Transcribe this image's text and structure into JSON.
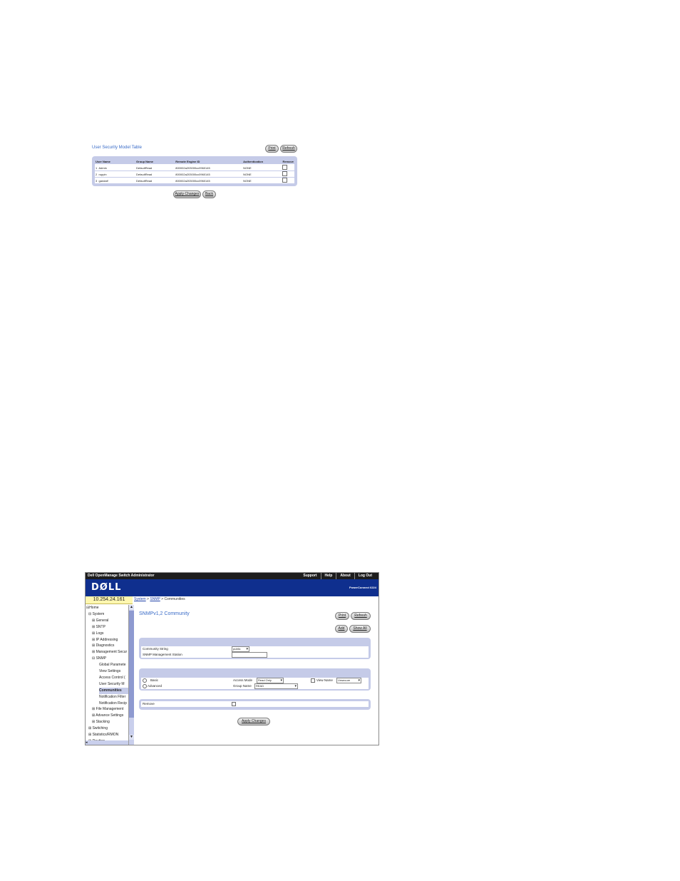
{
  "usm": {
    "title": "User Security Model Table",
    "print_label": "Print",
    "refresh_label": "Refresh",
    "columns": [
      "User Name",
      "Group Name",
      "Remote Engine ID",
      "Authentication",
      "Remove"
    ],
    "rows": [
      {
        "index": "1",
        "user": "Admin",
        "group": "DefaultRead",
        "engine": "800002a203000cc0960145",
        "auth": "NONE"
      },
      {
        "index": "2",
        "user": "ruppin",
        "group": "DefaultRead",
        "engine": "800002a203000cc0960145",
        "auth": "NONE"
      },
      {
        "index": "3",
        "user": "gandalf",
        "group": "DefaultRead",
        "engine": "800002a203000cc0960145",
        "auth": "NONE"
      }
    ],
    "apply_label": "Apply Changes",
    "back_label": "Back"
  },
  "dell": {
    "app_title": "Dell OpenManage Switch Administrator",
    "top_links": [
      "Support",
      "Help",
      "About",
      "Log Out"
    ],
    "logo": "DØLL",
    "model": "PowerConnect 6224",
    "ip": "10.254.24.161",
    "breadcrumb": {
      "system": "System",
      "sep1": " > ",
      "snmp": "SNMP",
      "sep2": " > ",
      "current": "Communities"
    },
    "nav": [
      {
        "label": "⊟Home",
        "indent": 0
      },
      {
        "label": "⊟ System",
        "indent": 1
      },
      {
        "label": "⊞ General",
        "indent": 2
      },
      {
        "label": "⊞ SNTP",
        "indent": 2
      },
      {
        "label": "⊞ Logs",
        "indent": 2
      },
      {
        "label": "⊞ IP Addressing",
        "indent": 2
      },
      {
        "label": "⊞ Diagnostics",
        "indent": 2
      },
      {
        "label": "⊞ Management Secur",
        "indent": 2
      },
      {
        "label": "⊟ SNMP",
        "indent": 2
      },
      {
        "label": "Global Paramete",
        "indent": 3
      },
      {
        "label": "View Settings",
        "indent": 3
      },
      {
        "label": "Access Control ( ",
        "indent": 3
      },
      {
        "label": "User Security M",
        "indent": 3
      },
      {
        "label": "Communities",
        "indent": 3,
        "selected": true
      },
      {
        "label": "Notification Filter",
        "indent": 3
      },
      {
        "label": "Notification Recip",
        "indent": 3
      },
      {
        "label": "⊞ File Management",
        "indent": 2
      },
      {
        "label": "⊞ Advance Settings",
        "indent": 2
      },
      {
        "label": "⊞ Stacking",
        "indent": 2
      },
      {
        "label": "⊞ Switching",
        "indent": 1
      },
      {
        "label": "⊞ Statistics/RMON",
        "indent": 1
      },
      {
        "label": "⊞ Routing",
        "indent": 1
      }
    ],
    "page_title": "SNMPv1,2 Community",
    "print_label": "Print",
    "refresh_label": "Refresh",
    "add_label": "Add",
    "show_all_label": "Show All",
    "community_string_label": "Community String",
    "community_string_value": "public",
    "mgmt_station_label": "SNMP Management Station",
    "basic_label": "Basic",
    "advanced_label": "Advanced",
    "access_mode_label": "Access Mode",
    "access_mode_value": "Read Only",
    "view_name_label": "View Name",
    "view_name_value": "Unsecure",
    "group_name_label": "Group Name",
    "group_name_value": "READ",
    "remove_label": "Remove",
    "apply_label": "Apply Changes"
  }
}
